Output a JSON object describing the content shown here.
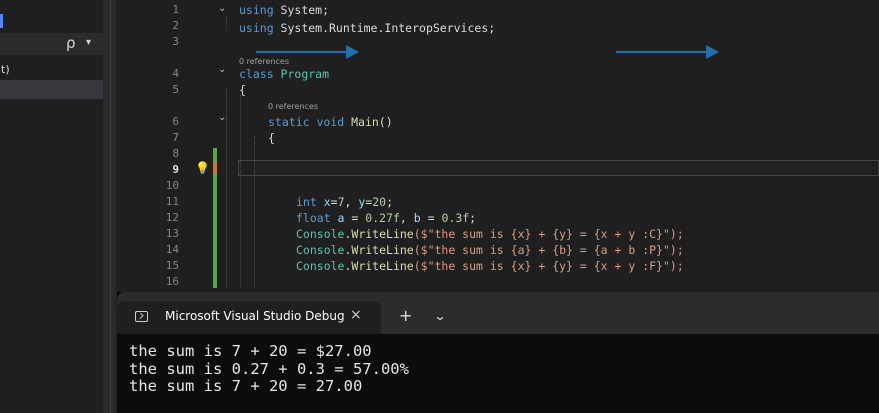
{
  "explorer": {
    "search_glyph": "ρ",
    "search_dropdown": "▾",
    "partial_label": "t)"
  },
  "editor": {
    "line_numbers": [
      "1",
      "2",
      "3",
      "4",
      "5",
      "6",
      "7",
      "8",
      "9",
      "10",
      "11",
      "12",
      "13",
      "14",
      "15",
      "16"
    ],
    "current_line": "9",
    "references_label": "0 references",
    "code": {
      "l1_kw": "using",
      "l1_ns": " System;",
      "l2_kw": "using",
      "l2_ns": " System.Runtime.InteropServices;",
      "l4_kw": "class",
      "l4_name": " Program",
      "l5": "{",
      "l6_kw": "static void",
      "l6_fn": " Main",
      "l6_paren": "()",
      "l7": "{",
      "l11_kw": "int",
      "l11_rest_a": " x",
      "l11_eq1": "=",
      "l11_n1": "7",
      "l11_comma": ", ",
      "l11_y": "y",
      "l11_eq2": "=",
      "l11_n2": "20",
      "l11_semi": ";",
      "l12_kw": "float",
      "l12_a": " a",
      "l12_eq1": " = ",
      "l12_n1": "0.27f",
      "l12_comma": ", ",
      "l12_b": "b",
      "l12_eq2": " = ",
      "l12_n2": "0.3f",
      "l12_semi": ";",
      "l13_obj": "Console",
      "l13_dot": ".",
      "l13_fn": "WriteLine",
      "l13_str": "($\"the sum is {x} + {y} = {x + y :C}\");",
      "l14_obj": "Console",
      "l14_dot": ".",
      "l14_fn": "WriteLine",
      "l14_str": "($\"the sum is {a} + {b} = {a + b :P}\");",
      "l15_obj": "Console",
      "l15_dot": ".",
      "l15_fn": "WriteLine",
      "l15_str": "($\"the sum is {x} + {y} = {x + y :F}\");"
    },
    "lightbulb_icon": "💡",
    "fold_glyph": "⌄"
  },
  "terminal": {
    "tab_title": "Microsoft Visual Studio Debug Console",
    "close_glyph": "×",
    "new_tab_glyph": "+",
    "dropdown_glyph": "⌄",
    "output": [
      "the sum is 7 + 20 = $27.00",
      "the sum is 0.27 + 0.3 = 57.00%",
      "the sum is 7 + 20 = 27.00"
    ]
  },
  "colors": {
    "annotation_arrow": "#1f6fb0",
    "change_bar": "#57a64a",
    "keyword": "#569cd6",
    "type": "#4ec9b0",
    "method": "#dcdcaa",
    "string": "#d69d85"
  }
}
